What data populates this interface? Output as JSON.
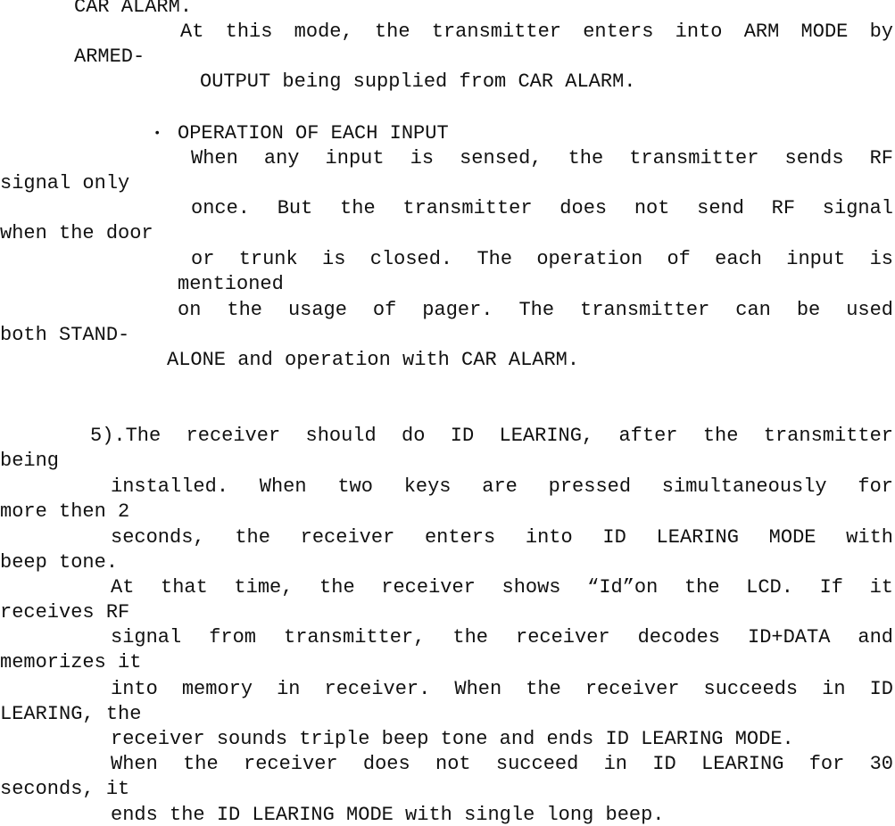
{
  "document": {
    "section_arm": {
      "lines": [
        "CAR ALARM.",
        "At this mode, the transmitter enters into ARM MODE by",
        "ARMED-",
        "OUTPUT being supplied from CAR ALARM."
      ]
    },
    "section_inputs": {
      "bullet": "•",
      "heading": "OPERATION OF EACH INPUT",
      "lines": [
        "When any input is sensed, the transmitter sends RF",
        "signal only",
        "once. But the transmitter does not send RF signal",
        "when the door",
        "or trunk is closed. The operation of each input is",
        "mentioned",
        "on the usage of pager. The transmitter can be used",
        "both STAND-",
        "ALONE and operation with CAR ALARM."
      ]
    },
    "section_5": {
      "lines": [
        "5).The receiver should do ID LEARING, after the transmitter",
        "being",
        "installed. When two keys are pressed simultaneously for",
        "more then 2",
        "seconds, the receiver enters into ID LEARING MODE with",
        "beep tone.",
        "At that time, the receiver shows “Id”on the LCD. If it",
        "receives RF",
        "signal from transmitter, the receiver decodes ID+DATA and",
        "memorizes it",
        "into memory in receiver. When the receiver succeeds in ID",
        "LEARING, the",
        "receiver sounds triple beep tone and ends ID LEARING MODE.",
        "When the receiver does not succeed in ID LEARING for 30",
        "seconds, it",
        "ends the ID LEARING MODE with single long beep."
      ]
    }
  }
}
